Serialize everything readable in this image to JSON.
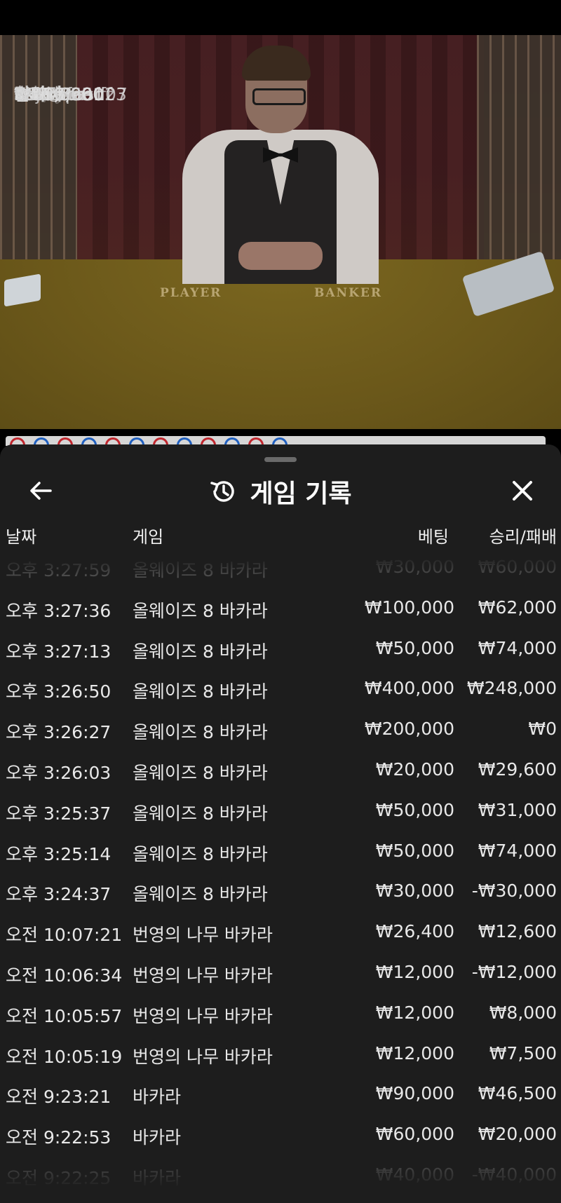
{
  "stream": {
    "table_labels": {
      "player": "PLAYER",
      "banker": "BANKER"
    },
    "chat": [
      {
        "amount": "₩280,000",
        "user": "asd07tasd07"
      },
      {
        "amount": "₩150,000",
        "user": "승여미"
      },
      {
        "amount": "₩120,000",
        "user": "힘차게"
      },
      {
        "amount": "₩119,361",
        "user": "sstiveprofff"
      },
      {
        "amount": "₩80,769",
        "user": "Kkjaanu"
      },
      {
        "amount": "₩65,593",
        "user": "Sk"
      },
      {
        "amount": "₩50,000",
        "user": "CSPrhfao123"
      },
      {
        "amount": "₩20,000",
        "user": "asvx"
      },
      {
        "amount": "₩20,000",
        "user": "달타냥?"
      },
      {
        "amount": "₩3,330",
        "user": "Saurya"
      }
    ]
  },
  "roadmap": {
    "colors": [
      "#c0262d",
      "#1f5fbf"
    ]
  },
  "panel": {
    "title": "게임 기록",
    "back_icon": "arrow-left-icon",
    "history_icon": "history-icon",
    "close_icon": "close-icon",
    "columns": {
      "date": "날짜",
      "game": "게임",
      "bet": "베팅",
      "result": "승리/패배"
    },
    "rows": [
      {
        "date": "오후 3:27:59",
        "game": "올웨이즈 8 바카라",
        "bet": "₩30,000",
        "result": "₩60,000"
      },
      {
        "date": "오후 3:27:36",
        "game": "올웨이즈 8 바카라",
        "bet": "₩100,000",
        "result": "₩62,000"
      },
      {
        "date": "오후 3:27:13",
        "game": "올웨이즈 8 바카라",
        "bet": "₩50,000",
        "result": "₩74,000"
      },
      {
        "date": "오후 3:26:50",
        "game": "올웨이즈 8 바카라",
        "bet": "₩400,000",
        "result": "₩248,000"
      },
      {
        "date": "오후 3:26:27",
        "game": "올웨이즈 8 바카라",
        "bet": "₩200,000",
        "result": "₩0"
      },
      {
        "date": "오후 3:26:03",
        "game": "올웨이즈 8 바카라",
        "bet": "₩20,000",
        "result": "₩29,600"
      },
      {
        "date": "오후 3:25:37",
        "game": "올웨이즈 8 바카라",
        "bet": "₩50,000",
        "result": "₩31,000"
      },
      {
        "date": "오후 3:25:14",
        "game": "올웨이즈 8 바카라",
        "bet": "₩50,000",
        "result": "₩74,000"
      },
      {
        "date": "오후 3:24:37",
        "game": "올웨이즈 8 바카라",
        "bet": "₩30,000",
        "result": "-₩30,000"
      },
      {
        "date": "오전 10:07:21",
        "game": "번영의 나무 바카라",
        "bet": "₩26,400",
        "result": "₩12,600"
      },
      {
        "date": "오전 10:06:34",
        "game": "번영의 나무 바카라",
        "bet": "₩12,000",
        "result": "-₩12,000"
      },
      {
        "date": "오전 10:05:57",
        "game": "번영의 나무 바카라",
        "bet": "₩12,000",
        "result": "₩8,000"
      },
      {
        "date": "오전 10:05:19",
        "game": "번영의 나무 바카라",
        "bet": "₩12,000",
        "result": "₩7,500"
      },
      {
        "date": "오전 9:23:21",
        "game": "바카라",
        "bet": "₩90,000",
        "result": "₩46,500"
      },
      {
        "date": "오전 9:22:53",
        "game": "바카라",
        "bet": "₩60,000",
        "result": "₩20,000"
      },
      {
        "date": "오전 9:22:25",
        "game": "바카라",
        "bet": "₩40,000",
        "result": "-₩40,000"
      }
    ]
  }
}
